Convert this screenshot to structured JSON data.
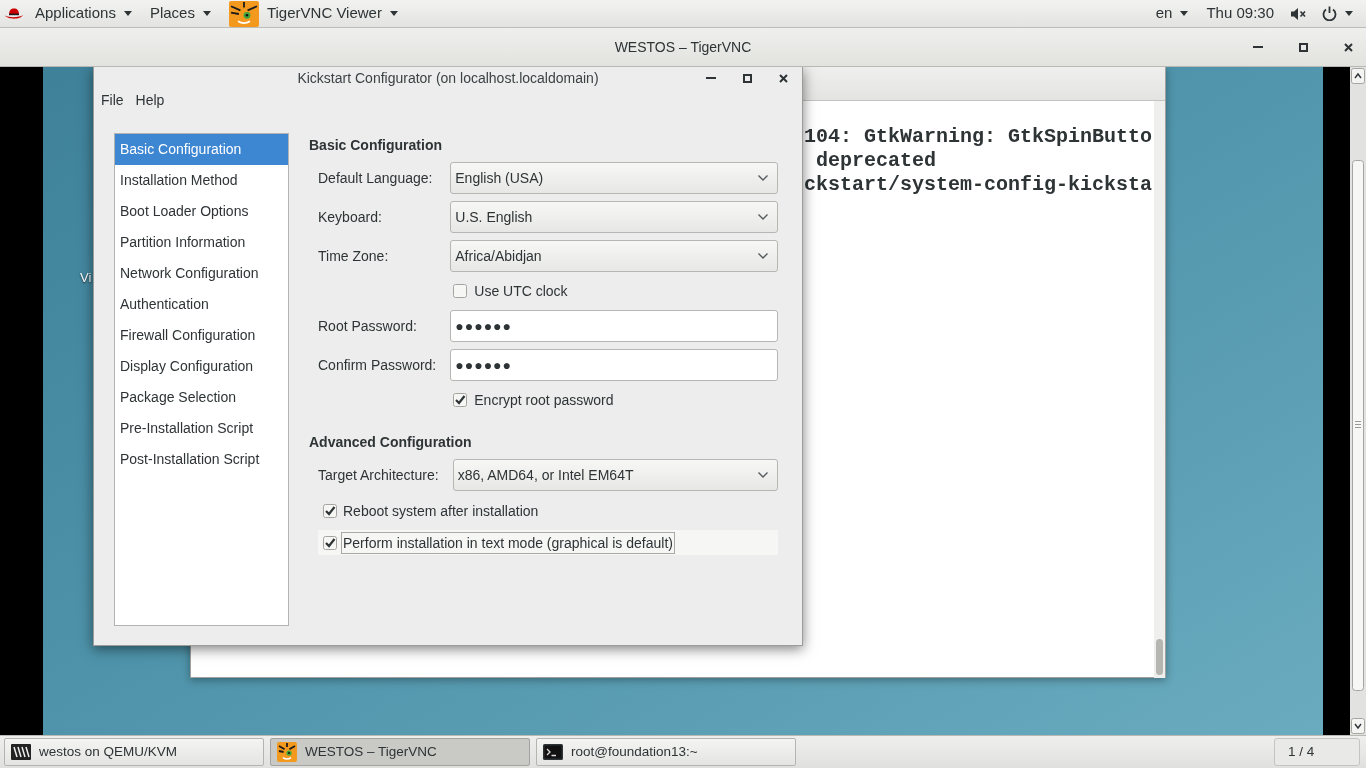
{
  "top_bar": {
    "menus": [
      {
        "kind": "menu",
        "label": "Applications"
      },
      {
        "kind": "menu",
        "label": "Places"
      },
      {
        "kind": "app_menu",
        "label": "TigerVNC Viewer"
      }
    ],
    "language": "en",
    "clock": "Thu 09:30"
  },
  "vnc_window": {
    "title": "WESTOS – TigerVNC"
  },
  "desktop": {
    "icon_labels": [
      "Vi"
    ]
  },
  "terminal": {
    "lines": [
      "104: GtkWarning: GtkSpinButto",
      " deprecated",
      "ckstart/system-config-kicksta"
    ]
  },
  "kickstart_window": {
    "title": "Kickstart Configurator (on localhost.localdomain)",
    "menu": [
      "File",
      "Help"
    ],
    "sidebar": {
      "items": [
        {
          "label": "Basic Configuration",
          "selected": true
        },
        {
          "label": "Installation Method",
          "selected": false
        },
        {
          "label": "Boot Loader Options",
          "selected": false
        },
        {
          "label": "Partition Information",
          "selected": false
        },
        {
          "label": "Network Configuration",
          "selected": false
        },
        {
          "label": "Authentication",
          "selected": false
        },
        {
          "label": "Firewall Configuration",
          "selected": false
        },
        {
          "label": "Display Configuration",
          "selected": false
        },
        {
          "label": "Package Selection",
          "selected": false
        },
        {
          "label": "Pre-Installation Script",
          "selected": false
        },
        {
          "label": "Post-Installation Script",
          "selected": false
        }
      ]
    },
    "sections": [
      {
        "heading": "Basic Configuration",
        "fields": [
          {
            "kind": "select",
            "label": "Default Language:",
            "value": "English (USA)"
          },
          {
            "kind": "select",
            "label": "Keyboard:",
            "value": "U.S. English"
          },
          {
            "kind": "select",
            "label": "Time Zone:",
            "value": "Africa/Abidjan"
          },
          {
            "kind": "checkbox",
            "label": "Use UTC clock",
            "checked": false
          },
          {
            "kind": "password",
            "label": "Root Password:",
            "value": "●●●●●●"
          },
          {
            "kind": "password",
            "label": "Confirm Password:",
            "value": "●●●●●●"
          },
          {
            "kind": "checkbox",
            "label": "Encrypt root password",
            "checked": true
          }
        ]
      },
      {
        "heading": "Advanced Configuration",
        "fields": [
          {
            "kind": "select",
            "label": "Target Architecture:",
            "value": "x86, AMD64, or Intel EM64T"
          },
          {
            "kind": "check_row",
            "label": "Reboot system after installation",
            "checked": true,
            "focused": false
          },
          {
            "kind": "check_row",
            "label": "Perform installation in text mode (graphical is default)",
            "checked": true,
            "focused": true
          }
        ]
      }
    ]
  },
  "taskbar": {
    "items": [
      {
        "kind": "vm",
        "label": "westos on QEMU/KVM",
        "selected": false
      },
      {
        "kind": "vnc",
        "label": "WESTOS – TigerVNC",
        "selected": true
      },
      {
        "kind": "terminal",
        "label": "root@foundation13:~",
        "selected": false
      }
    ],
    "workspace": "1 / 4"
  }
}
